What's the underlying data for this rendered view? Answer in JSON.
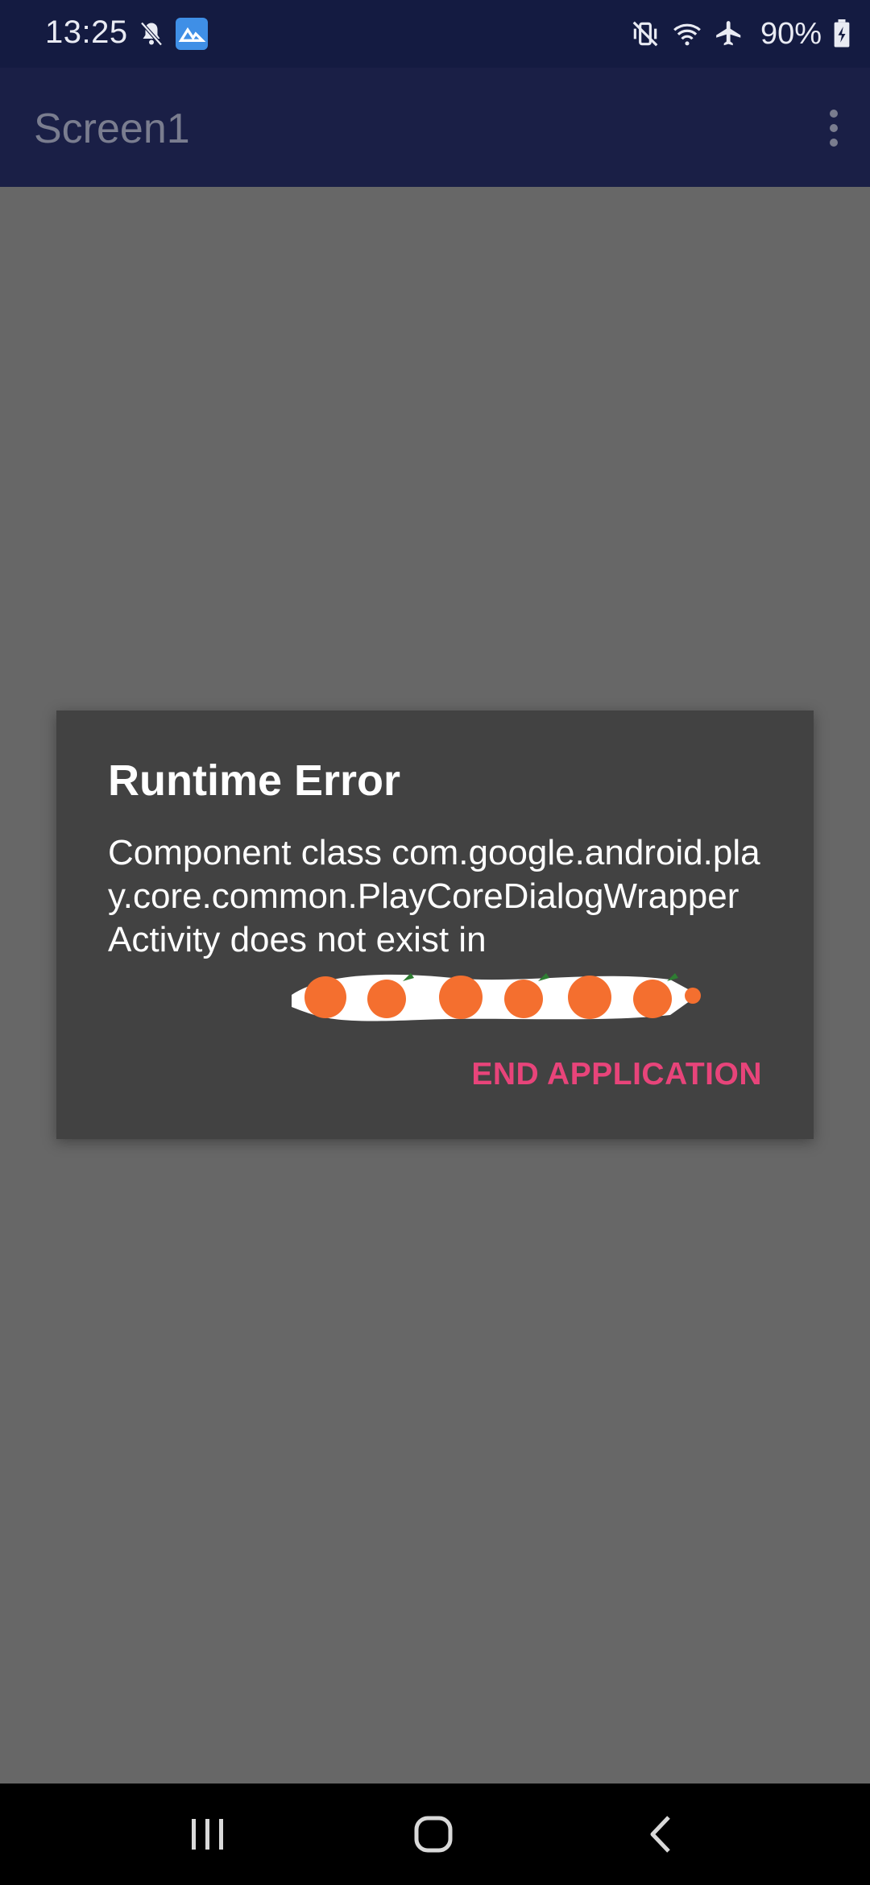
{
  "status_bar": {
    "time": "13:25",
    "battery_text": "90%",
    "icons": [
      "mute-notifications-icon",
      "gallery-app-icon",
      "vibrate-mute-icon",
      "wifi-icon",
      "airplane-mode-icon",
      "battery-charging-icon"
    ]
  },
  "app_bar": {
    "title": "Screen1",
    "menu_icon": "more-vert-icon"
  },
  "dialog": {
    "title": "Runtime Error",
    "message": "Component class com.google.android.play.core.common.PlayCoreDialogWrapperActivity does not exist in",
    "button_label": "END APPLICATION",
    "accent_color": "#e8447a"
  },
  "nav_bar": {
    "icons": [
      "recent-apps-icon",
      "home-icon",
      "back-icon"
    ]
  }
}
